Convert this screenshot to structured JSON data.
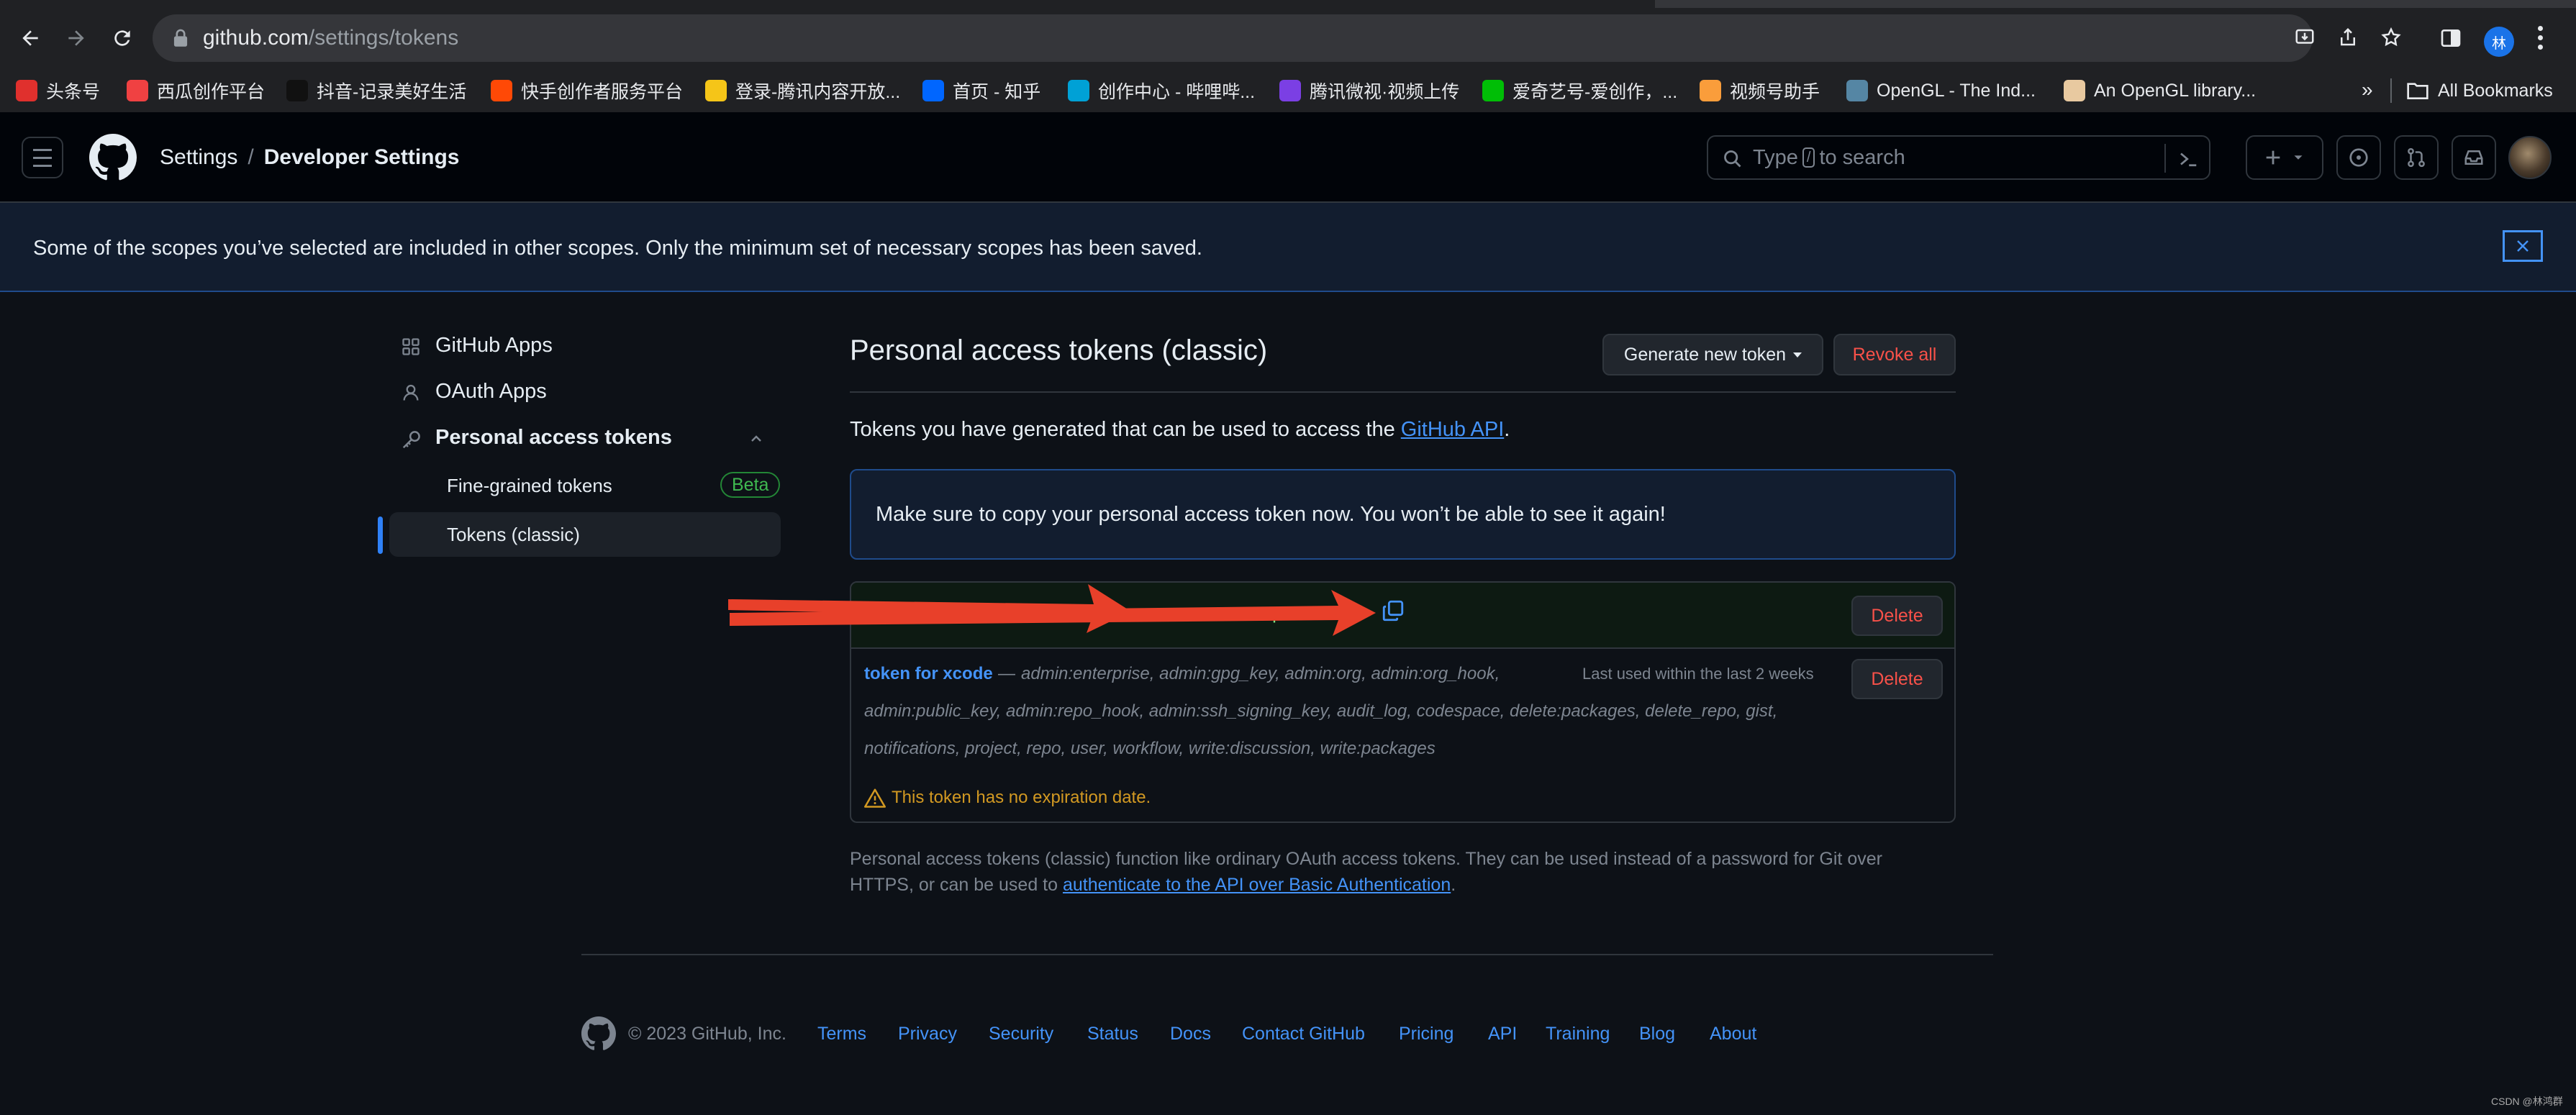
{
  "browser": {
    "url_domain": "github.com",
    "url_path": "/settings/tokens",
    "profile_initial": "林",
    "bookmarks": [
      {
        "label": "头条号",
        "color": "#e0302d",
        "icon": "toutiao-icon"
      },
      {
        "label": "西瓜创作平台",
        "color": "#f04142",
        "icon": "xigua-icon"
      },
      {
        "label": "抖音-记录美好生活",
        "color": "#111111",
        "icon": "douyin-icon"
      },
      {
        "label": "快手创作者服务平台",
        "color": "#ff4906",
        "icon": "kuaishou-icon"
      },
      {
        "label": "登录-腾讯内容开放...",
        "color": "#f5c518",
        "icon": "tencent-bell-icon"
      },
      {
        "label": "首页 - 知乎",
        "color": "#0066ff",
        "icon": "zhihu-icon"
      },
      {
        "label": "创作中心 - 哔哩哔...",
        "color": "#00a1d6",
        "icon": "bilibili-icon"
      },
      {
        "label": "腾讯微视·视频上传",
        "color": "#7b3fe4",
        "icon": "weishi-icon"
      },
      {
        "label": "爱奇艺号-爱创作，...",
        "color": "#00be06",
        "icon": "iqiyi-icon"
      },
      {
        "label": "视频号助手",
        "color": "#fa9d3b",
        "icon": "channels-icon"
      },
      {
        "label": "OpenGL - The Ind...",
        "color": "#5586a4",
        "icon": "opengl-icon"
      },
      {
        "label": "An OpenGL library...",
        "color": "#e8c9a0",
        "icon": "glfw-icon"
      }
    ],
    "bookmarks_overflow": "»",
    "all_bookmarks": "All Bookmarks"
  },
  "header": {
    "crumb_settings": "Settings",
    "crumb_sep": "/",
    "crumb_current": "Developer Settings",
    "search_prefix": "Type",
    "search_key": "/",
    "search_suffix": "to search"
  },
  "flash": {
    "message": "Some of the scopes you’ve selected are included in other scopes. Only the minimum set of necessary scopes has been saved."
  },
  "sidebar": {
    "github_apps": "GitHub Apps",
    "oauth_apps": "OAuth Apps",
    "pat": "Personal access tokens",
    "fine_grained": "Fine-grained tokens",
    "beta": "Beta",
    "classic": "Tokens (classic)"
  },
  "main": {
    "title": "Personal access tokens (classic)",
    "generate_button": "Generate new token",
    "revoke_all": "Revoke all",
    "desc_prefix": "Tokens you have generated that can be used to access the ",
    "desc_link": "GitHub API",
    "desc_suffix": ".",
    "notice": "Make sure to copy your personal access token now. You won’t be able to see it again!",
    "new_token_value": "ghp_••••••••••••••••••••••••••••••p",
    "delete": "Delete",
    "token": {
      "name": "token for xcode",
      "dash": "—",
      "scopes_line1": "admin:enterprise, admin:gpg_key, admin:org, admin:org_hook,",
      "scopes_line2": "admin:public_key, admin:repo_hook, admin:ssh_signing_key, audit_log, codespace, delete:packages, delete_repo, gist,",
      "scopes_line3": "notifications, project, repo, user, workflow, write:discussion, write:packages",
      "last_used": "Last used within the last 2 weeks",
      "warning": "This token has no expiration date."
    },
    "footnote_line1": "Personal access tokens (classic) function like ordinary OAuth access tokens. They can be used instead of a password for Git over",
    "footnote_line2_prefix": "HTTPS, or can be used to ",
    "footnote_link": "authenticate to the API over Basic Authentication",
    "footnote_line2_suffix": "."
  },
  "footer": {
    "copyright": "© 2023 GitHub, Inc.",
    "links": [
      "Terms",
      "Privacy",
      "Security",
      "Status",
      "Docs",
      "Contact GitHub",
      "Pricing",
      "API",
      "Training",
      "Blog",
      "About"
    ]
  },
  "watermark": "CSDN @林鸿群",
  "annotation": {
    "arrow_color": "#e8402a"
  }
}
